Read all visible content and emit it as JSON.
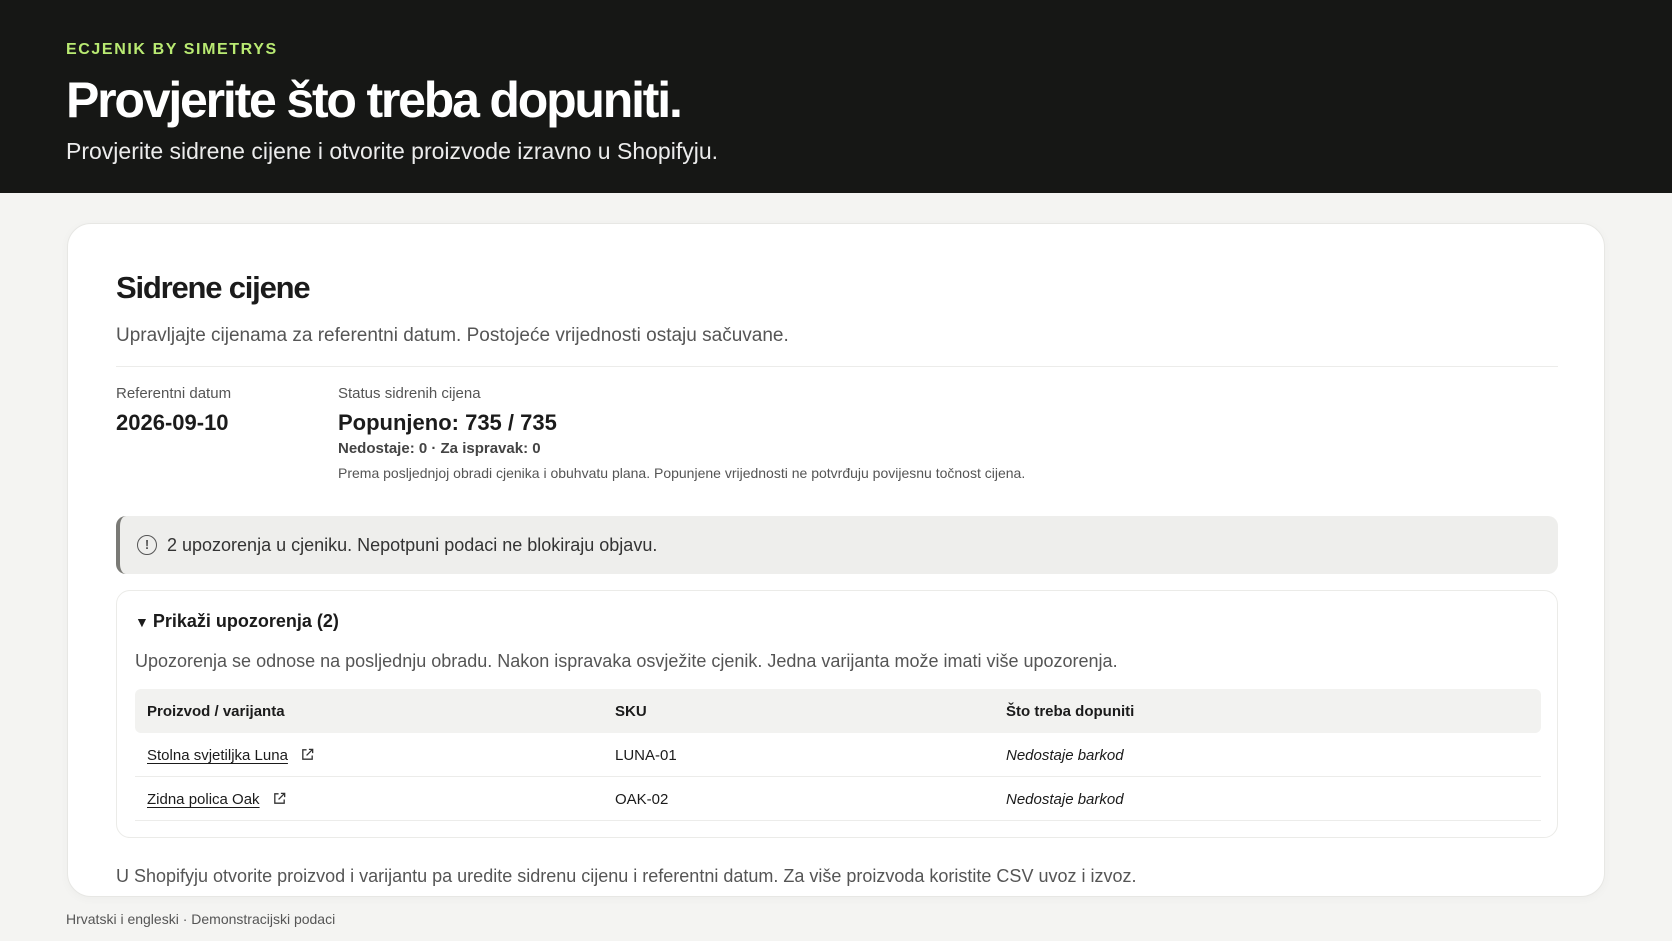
{
  "header": {
    "eyebrow": "ECJENIK BY SIMETRYS",
    "title": "Provjerite što treba dopuniti.",
    "subtitle": "Provjerite sidrene cijene i otvorite proizvode izravno u Shopifyju."
  },
  "card": {
    "title": "Sidrene cijene",
    "description": "Upravljajte cijenama za referentni datum. Postojeće vrijednosti ostaju sačuvane.",
    "reference_date_label": "Referentni datum",
    "reference_date_value": "2026-09-10",
    "status_label": "Status sidrenih cijena",
    "status_value": "Popunjeno: 735 / 735",
    "status_detail": "Nedostaje: 0 · Za ispravak: 0",
    "status_note": "Prema posljednjoj obradi cjenika i obuhvatu plana. Popunjene vrijednosti ne potvrđuju povijesnu točnost cijena."
  },
  "alert": {
    "icon": "info-circle-icon",
    "text": "2 upozorenja u cjeniku. Nepotpuni podaci ne blokiraju objavu."
  },
  "warnings": {
    "toggle_label": "Prikaži upozorenja (2)",
    "description": "Upozorenja se odnose na posljednju obradu. Nakon ispravaka osvježite cjenik. Jedna varijanta može imati više upozorenja.",
    "columns": [
      "Proizvod / varijanta",
      "SKU",
      "Što treba dopuniti"
    ],
    "rows": [
      {
        "product": "Stolna svjetiljka Luna",
        "sku": "LUNA-01",
        "issue": "Nedostaje barkod"
      },
      {
        "product": "Zidna polica Oak",
        "sku": "OAK-02",
        "issue": "Nedostaje barkod"
      }
    ]
  },
  "card_footer": "U Shopifyju otvorite proizvod i varijantu pa uredite sidrenu cijenu i referentni datum. Za više proizvoda koristite CSV uvoz i izvoz.",
  "page_footer": "Hrvatski i engleski · Demonstracijski podaci",
  "colors": {
    "hero_bg": "#161715",
    "accent": "#b9ea72",
    "card_bg": "#ffffff",
    "page_bg": "#f4f4f2"
  }
}
